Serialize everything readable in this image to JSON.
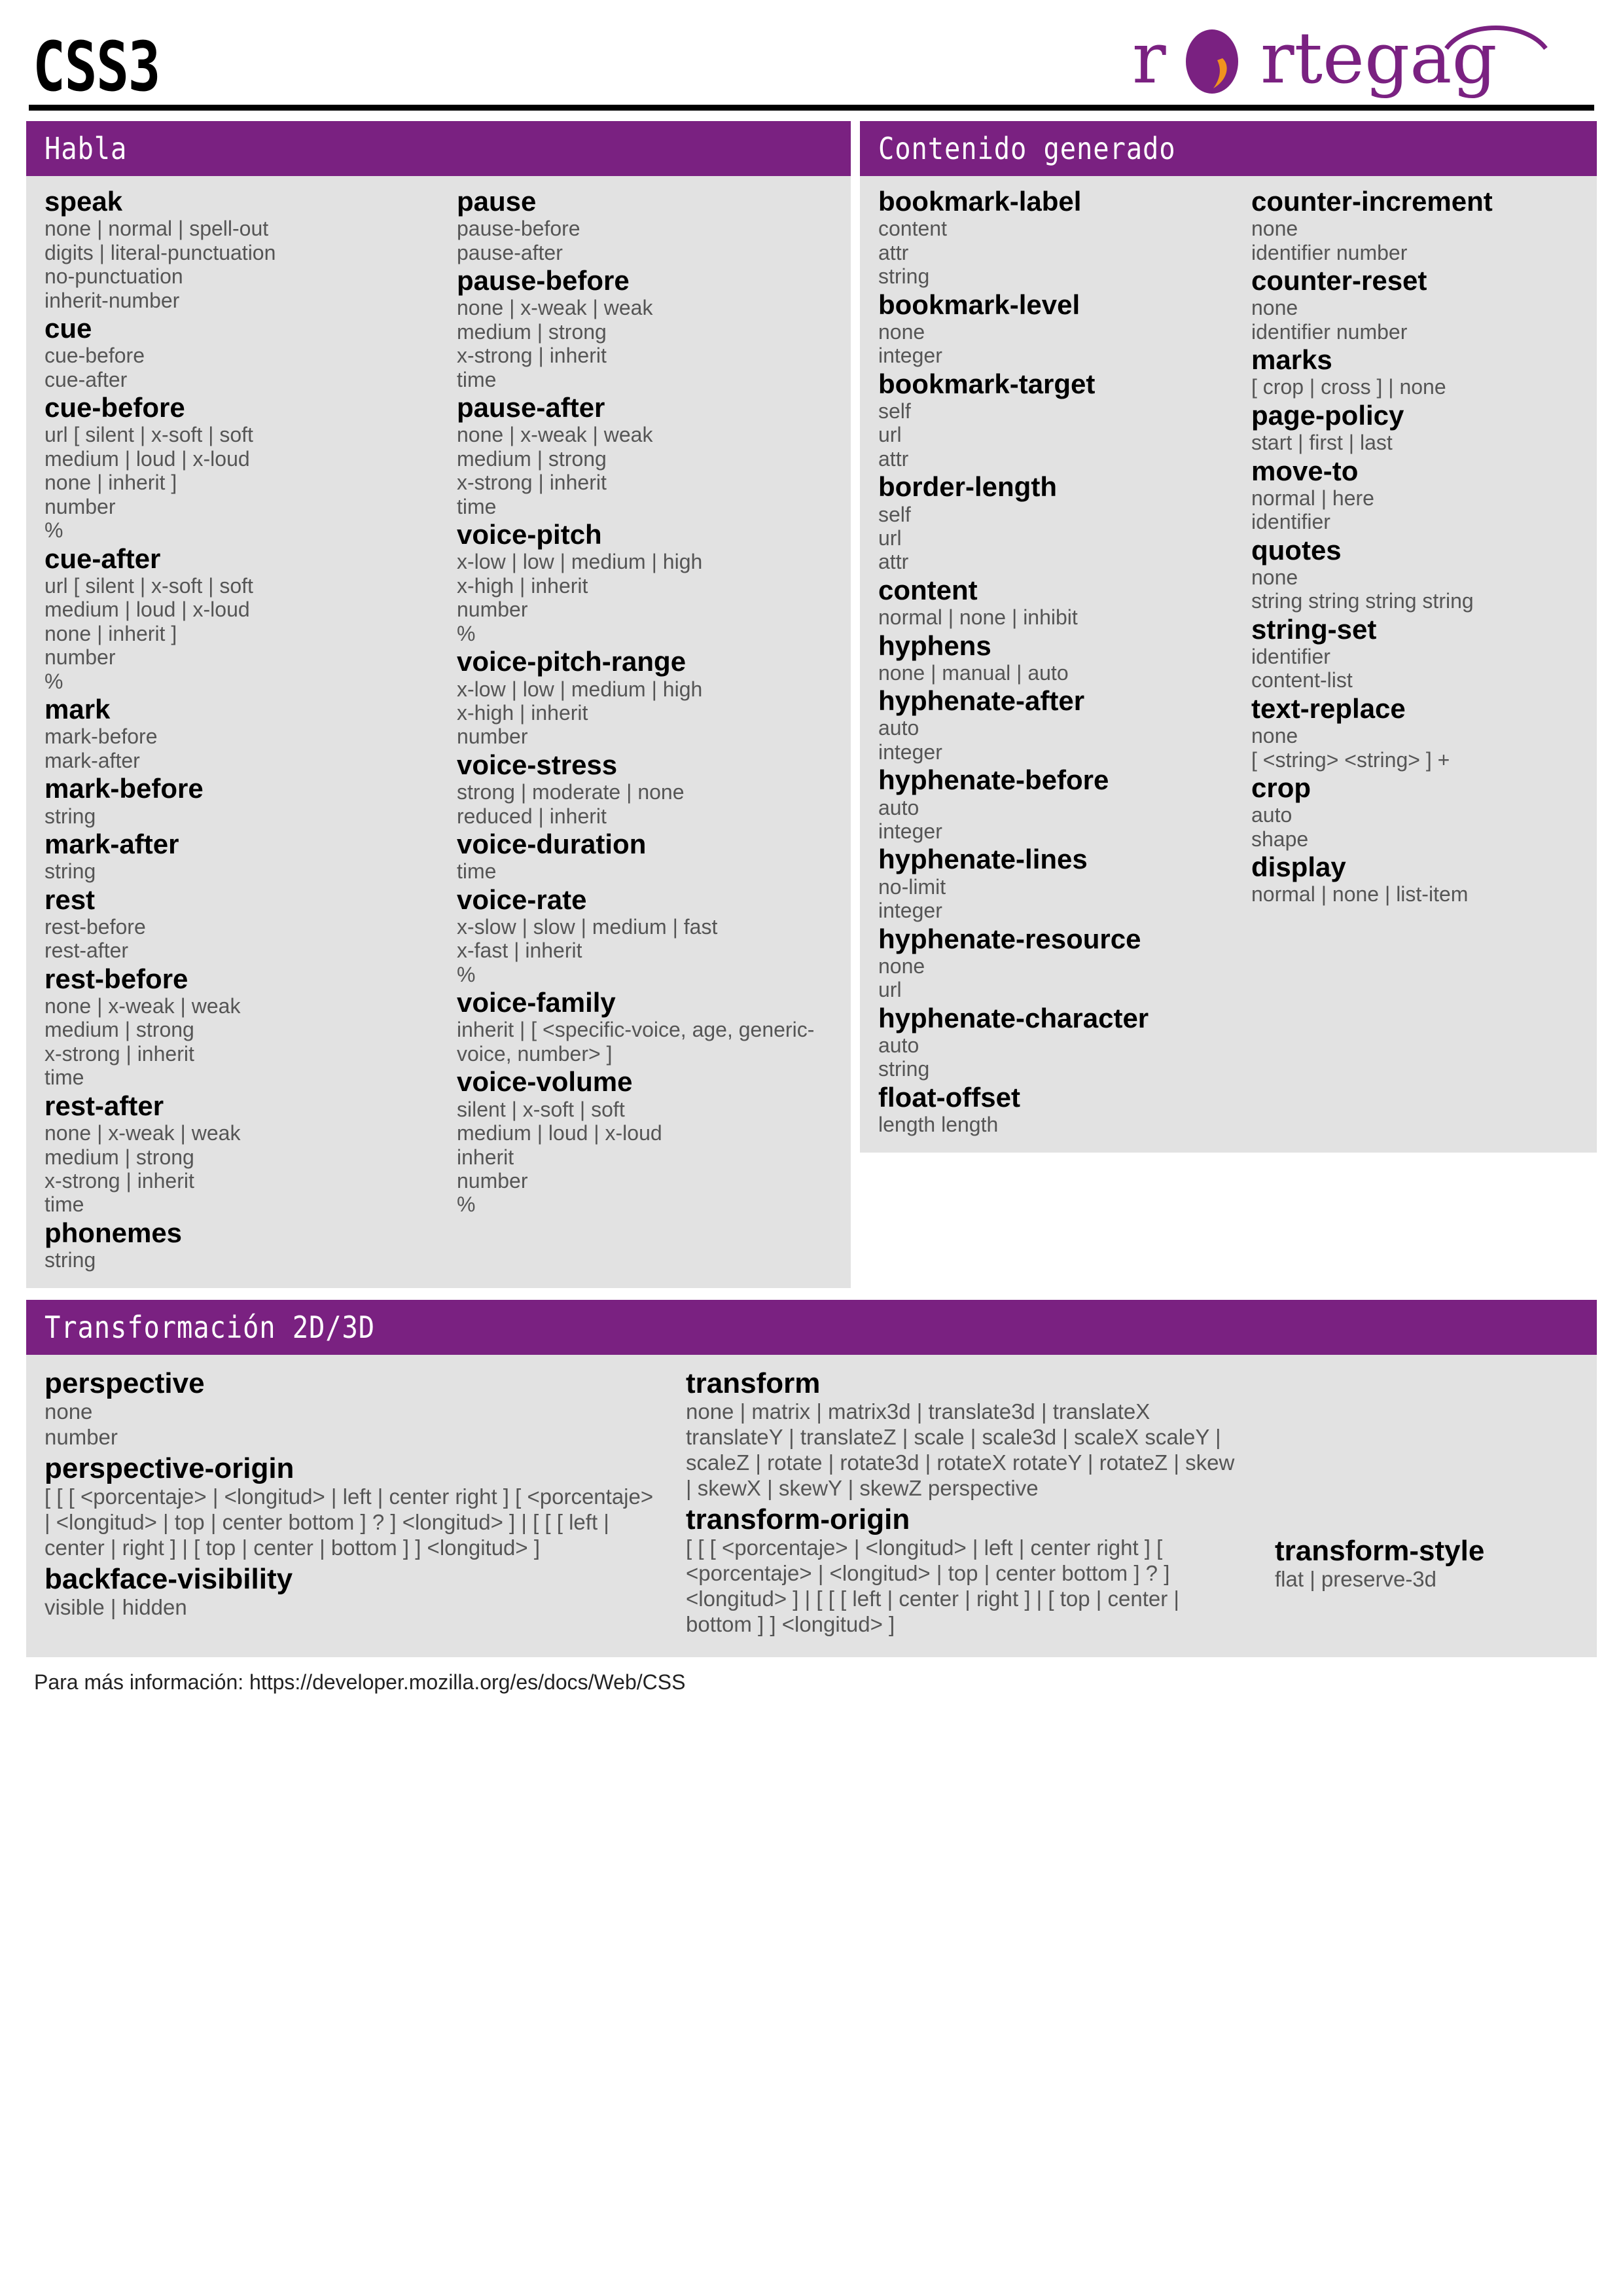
{
  "header": {
    "title": "CSS3",
    "logo_text": "rortegag",
    "logo_purple": "#7a2181",
    "logo_orange": "#f0921e"
  },
  "colors": {
    "header_purple": "#7a2181",
    "panel_bg": "#e2e2e2",
    "prop_color": "#000000",
    "value_color": "#555555"
  },
  "sections": [
    {
      "id": "habla",
      "title": "Habla",
      "columns": [
        {
          "entries": [
            {
              "prop": "speak",
              "values": [
                "none | normal | spell-out",
                "digits | literal-punctuation",
                "no-punctuation",
                "inherit-number"
              ]
            },
            {
              "prop": "cue",
              "values": [
                "cue-before",
                "cue-after"
              ]
            },
            {
              "prop": "cue-before",
              "values": [
                "url [ silent | x-soft | soft",
                "medium | loud | x-loud",
                "none | inherit ]",
                "number",
                "%"
              ]
            },
            {
              "prop": "cue-after",
              "values": [
                "url [ silent | x-soft | soft",
                "medium | loud | x-loud",
                "none | inherit ]",
                "number",
                "%"
              ]
            },
            {
              "prop": "mark",
              "values": [
                "mark-before",
                "mark-after"
              ]
            },
            {
              "prop": "mark-before",
              "values": [
                "string"
              ]
            },
            {
              "prop": "mark-after",
              "values": [
                "string"
              ]
            },
            {
              "prop": "rest",
              "values": [
                "rest-before",
                "rest-after"
              ]
            },
            {
              "prop": "rest-before",
              "values": [
                "none | x-weak | weak",
                "medium | strong",
                "x-strong | inherit",
                "time"
              ]
            },
            {
              "prop": "rest-after",
              "values": [
                "none | x-weak | weak",
                "medium | strong",
                "x-strong | inherit",
                "time"
              ]
            },
            {
              "prop": "phonemes",
              "values": [
                "string"
              ]
            }
          ]
        },
        {
          "entries": [
            {
              "prop": "pause",
              "values": [
                "pause-before",
                "pause-after"
              ]
            },
            {
              "prop": "pause-before",
              "values": [
                "none | x-weak | weak",
                "medium | strong",
                "x-strong | inherit",
                "time"
              ]
            },
            {
              "prop": "pause-after",
              "values": [
                "none | x-weak | weak",
                "medium | strong",
                "x-strong | inherit",
                "time"
              ]
            },
            {
              "prop": "voice-pitch",
              "values": [
                "x-low | low | medium | high",
                "x-high | inherit",
                "number",
                "%"
              ]
            },
            {
              "prop": "voice-pitch-range",
              "values": [
                "x-low | low | medium | high",
                "x-high | inherit",
                "number"
              ]
            },
            {
              "prop": "voice-stress",
              "values": [
                "strong | moderate | none",
                "reduced | inherit"
              ]
            },
            {
              "prop": "voice-duration",
              "values": [
                "time"
              ]
            },
            {
              "prop": "voice-rate",
              "values": [
                "x-slow | slow | medium | fast",
                "x-fast | inherit",
                "%"
              ]
            },
            {
              "prop": "voice-family",
              "values": [
                "inherit | [ <specific-voice, age, generic-voice, number> ]"
              ],
              "wrap": true
            },
            {
              "prop": "voice-volume",
              "values": [
                "silent | x-soft | soft",
                "medium | loud | x-loud",
                "inherit",
                "number",
                "%"
              ]
            }
          ]
        }
      ]
    },
    {
      "id": "contenido-generado",
      "title": "Contenido generado",
      "columns": [
        {
          "entries": [
            {
              "prop": "bookmark-label",
              "values": [
                "content",
                "attr",
                "string"
              ]
            },
            {
              "prop": "bookmark-level",
              "values": [
                "none",
                "integer"
              ]
            },
            {
              "prop": "bookmark-target",
              "values": [
                "self",
                "url",
                "attr"
              ]
            },
            {
              "prop": "border-length",
              "values": [
                "self",
                "url",
                "attr"
              ]
            },
            {
              "prop": "content",
              "values": [
                "normal | none | inhibit"
              ]
            },
            {
              "prop": "hyphens",
              "values": [
                "none | manual | auto"
              ]
            },
            {
              "prop": "hyphenate-after",
              "values": [
                "auto",
                "integer"
              ]
            },
            {
              "prop": "hyphenate-before",
              "values": [
                "auto",
                "integer"
              ]
            },
            {
              "prop": "hyphenate-lines",
              "values": [
                "no-limit",
                "integer"
              ]
            },
            {
              "prop": "hyphenate-resource",
              "values": [
                "none",
                "url"
              ]
            },
            {
              "prop": "hyphenate-character",
              "values": [
                "auto",
                "string"
              ]
            },
            {
              "prop": "float-offset",
              "values": [
                "length length"
              ]
            }
          ]
        },
        {
          "entries": [
            {
              "prop": "counter-increment",
              "values": [
                "none",
                "identifier number"
              ]
            },
            {
              "prop": "counter-reset",
              "values": [
                "none",
                "identifier number"
              ]
            },
            {
              "prop": "marks",
              "values": [
                "[ crop | cross ] | none"
              ]
            },
            {
              "prop": "page-policy",
              "values": [
                "start | first | last"
              ]
            },
            {
              "prop": "move-to",
              "values": [
                "normal | here",
                "identifier"
              ]
            },
            {
              "prop": "quotes",
              "values": [
                "none",
                "string string string string"
              ]
            },
            {
              "prop": "string-set",
              "values": [
                "identifier",
                "content-list"
              ]
            },
            {
              "prop": "text-replace",
              "values": [
                "none",
                "[ <string> <string> ] +"
              ]
            },
            {
              "prop": "crop",
              "values": [
                "auto",
                "shape"
              ]
            },
            {
              "prop": "display",
              "values": [
                "normal | none | list-item"
              ]
            }
          ]
        }
      ]
    }
  ],
  "transform_section": {
    "id": "transformacion-2d-3d",
    "title": "Transformación 2D/3D",
    "left_entries": [
      {
        "prop": "perspective",
        "values": [
          "none",
          "number"
        ],
        "wrap": false
      },
      {
        "prop": "perspective-origin",
        "values": [
          "[ [ [ <porcentaje> | <longitud> | left | center right ] [ <porcentaje> | <longitud> | top | center bottom ] ? ] <longitud> ] | [ [ [ left | center | right ] | [ top | center | bottom ] ] <longitud> ]"
        ],
        "wrap": true
      },
      {
        "prop": "backface-visibility",
        "values": [
          "visible | hidden"
        ],
        "wrap": false
      }
    ],
    "mid_entries": [
      {
        "prop": "transform",
        "values": [
          "none | matrix | matrix3d | translate3d | translateX translateY | translateZ | scale | scale3d | scaleX scaleY | scaleZ | rotate | rotate3d | rotateX rotateY | rotateZ | skew | skewX | skewY | skewZ perspective"
        ],
        "wrap": true
      },
      {
        "prop": "transform-origin",
        "values": [
          "[ [ [ <porcentaje> | <longitud> | left | center right ] [ <porcentaje> | <longitud> | top | center bottom ] ? ] <longitud> ] | [ [ [ left | center | right ] | [ top | center | bottom ] ] <longitud> ]"
        ],
        "wrap": true
      }
    ],
    "right_entries": [
      {
        "prop": "transform-style",
        "values": [
          "flat | preserve-3d"
        ],
        "wrap": false
      }
    ]
  },
  "footer": {
    "text": "Para más información: https://developer.mozilla.org/es/docs/Web/CSS"
  }
}
